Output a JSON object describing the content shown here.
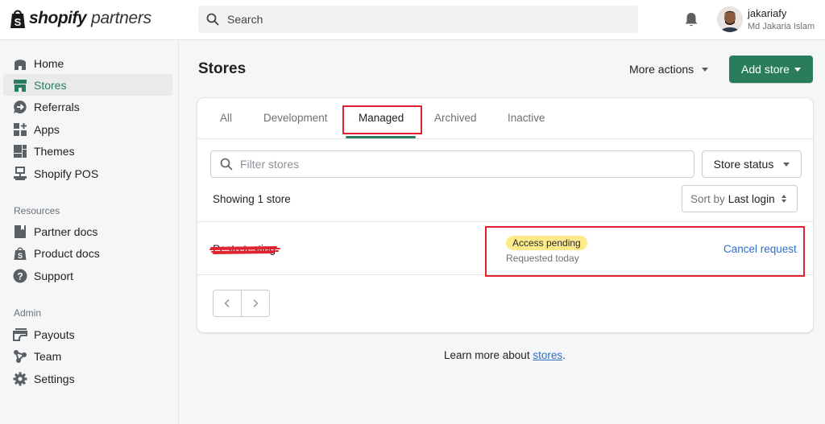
{
  "topbar": {
    "brand": "shopify",
    "brand_suffix": "partners",
    "search_placeholder": "Search",
    "user": {
      "username": "jakariafy",
      "full_name": "Md Jakaria Islam"
    }
  },
  "sidebar": {
    "items": [
      {
        "label": "Home",
        "icon": "home-icon"
      },
      {
        "label": "Stores",
        "icon": "store-icon",
        "active": true
      },
      {
        "label": "Referrals",
        "icon": "referrals-icon"
      },
      {
        "label": "Apps",
        "icon": "apps-icon"
      },
      {
        "label": "Themes",
        "icon": "themes-icon"
      },
      {
        "label": "Shopify POS",
        "icon": "pos-icon"
      }
    ],
    "resources_label": "Resources",
    "resources": [
      {
        "label": "Partner docs",
        "icon": "book-icon"
      },
      {
        "label": "Product docs",
        "icon": "shopify-bag-icon"
      },
      {
        "label": "Support",
        "icon": "question-icon"
      }
    ],
    "admin_label": "Admin",
    "admin": [
      {
        "label": "Payouts",
        "icon": "payouts-icon"
      },
      {
        "label": "Team",
        "icon": "team-icon"
      },
      {
        "label": "Settings",
        "icon": "gear-icon"
      }
    ]
  },
  "page": {
    "title": "Stores",
    "more_actions": "More actions",
    "add_store": "Add store"
  },
  "tabs": [
    {
      "label": "All"
    },
    {
      "label": "Development"
    },
    {
      "label": "Managed",
      "active": true
    },
    {
      "label": "Archived"
    },
    {
      "label": "Inactive"
    }
  ],
  "filters": {
    "filter_placeholder": "Filter stores",
    "store_status": "Store status",
    "showing": "Showing 1 store",
    "sort_label": "Sort by",
    "sort_value": "Last login"
  },
  "stores": [
    {
      "name": "Pesto testing",
      "status_badge": "Access pending",
      "requested": "Requested today",
      "action": "Cancel request"
    }
  ],
  "footer": {
    "prefix": "Learn more about ",
    "link": "stores",
    "suffix": "."
  },
  "colors": {
    "accent": "#2a7d5c",
    "link": "#2c6ecb",
    "badge_pending": "#ffea8a",
    "annotation": "#e0232f"
  }
}
